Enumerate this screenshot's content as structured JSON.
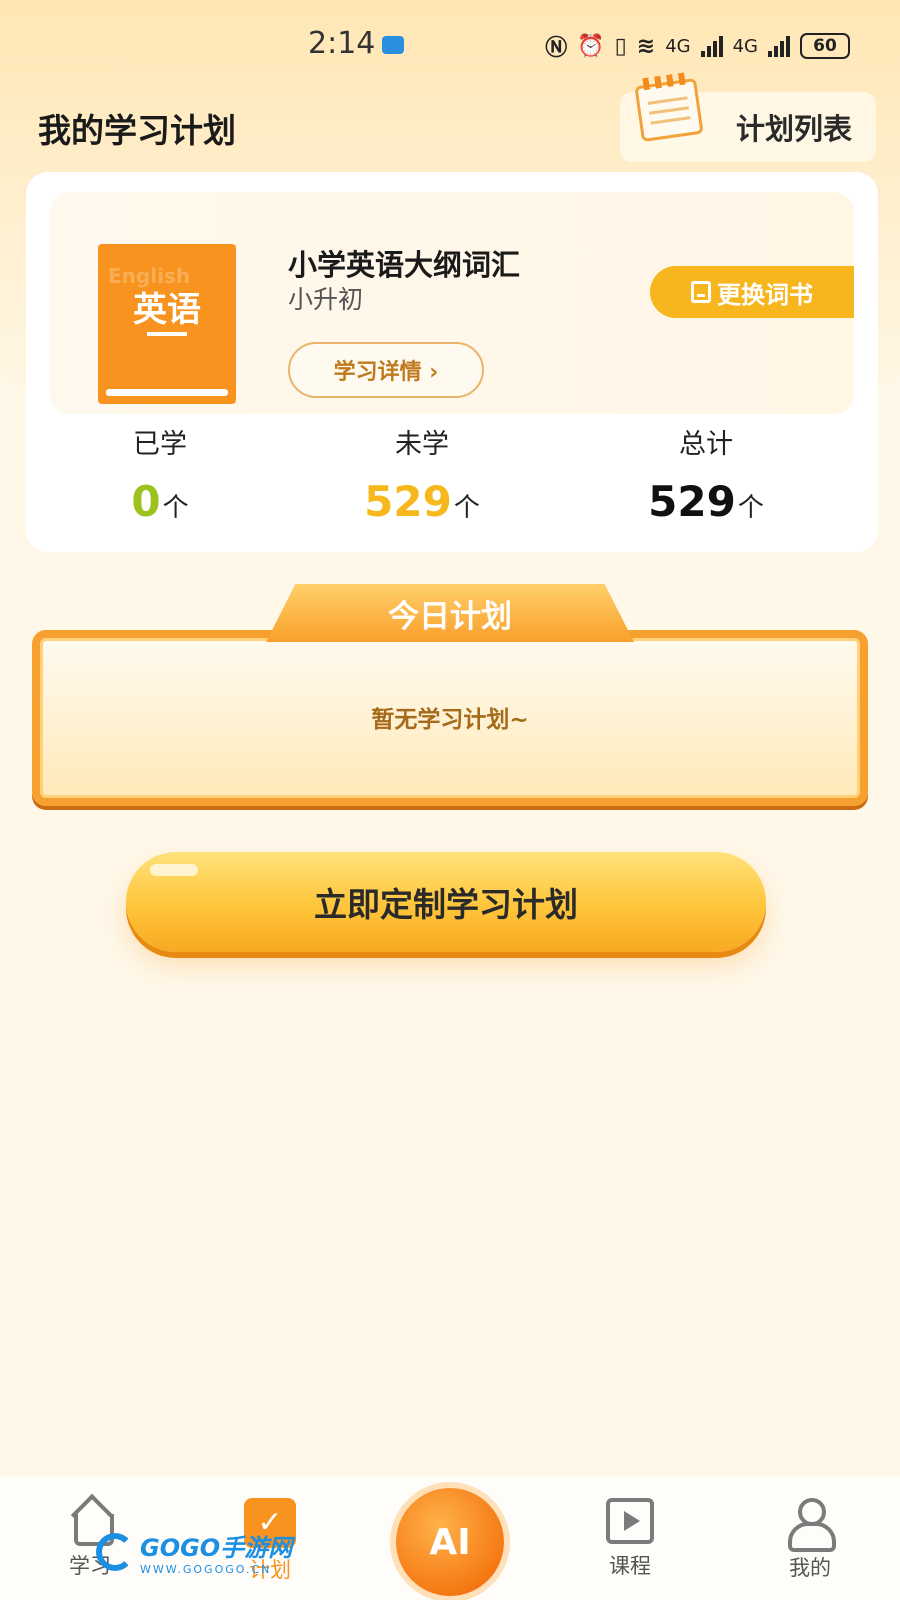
{
  "status": {
    "time": "2:14",
    "network": "4G",
    "battery": "60",
    "wifi_gen": "6"
  },
  "header": {
    "title": "我的学习计划",
    "plan_list_label": "计划列表"
  },
  "book": {
    "cover_text": "英语",
    "cover_faint": "English",
    "title": "小学英语大纲词汇",
    "subtitle": "小升初",
    "detail_label": "学习详情 ›",
    "change_label": "更换词书"
  },
  "stats": {
    "learned": {
      "label": "已学",
      "value": "0",
      "unit": "个",
      "color": "#9bc21d"
    },
    "unlearned": {
      "label": "未学",
      "value": "529",
      "unit": "个",
      "color": "#f6b81c"
    },
    "total": {
      "label": "总计",
      "value": "529",
      "unit": "个",
      "color": "#111111"
    }
  },
  "today": {
    "title": "今日计划",
    "empty_text": "暂无学习计划~"
  },
  "cta_label": "立即定制学习计划",
  "tabbar": {
    "learn": "学习",
    "plan": "计划",
    "ai": "AI",
    "course": "课程",
    "mine": "我的"
  },
  "watermark": {
    "main": "GOGO手游网",
    "sub": "WWW.GOGOGO.CN"
  },
  "colors": {
    "accent": "#f7931e",
    "brand_yellow": "#ffc53a"
  }
}
